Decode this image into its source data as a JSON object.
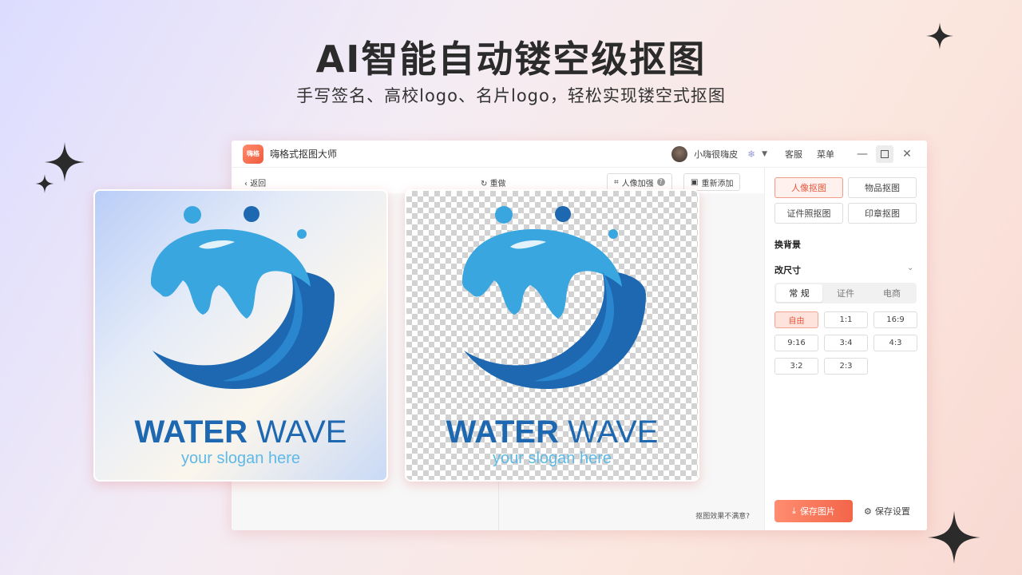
{
  "promo": {
    "headline": "AI智能自动镂空级抠图",
    "subline": "手写签名、高校logo、名片logo，轻松实现镂空式抠图"
  },
  "window": {
    "app_name": "嗨格式抠图大师",
    "app_logo_text": "嗨格",
    "username": "小嗨很嗨皮",
    "service": "客服",
    "menu": "菜单",
    "toolbar": {
      "back": "返回",
      "redo": "重做",
      "enhance": "人像加强",
      "help": "?",
      "re_add": "重新添加"
    },
    "canvas": {
      "dissatisfied": "抠图效果不满意?"
    },
    "sidebar": {
      "modes": [
        "人像抠图",
        "物品抠图",
        "证件照抠图",
        "印章抠图"
      ],
      "active_mode": "人像抠图",
      "change_bg": "换背景",
      "change_size": "改尺寸",
      "size_tabs": [
        "常 规",
        "证件",
        "电商"
      ],
      "ratios": [
        "自由",
        "1:1",
        "16:9",
        "9:16",
        "3:4",
        "4:3",
        "3:2",
        "2:3"
      ],
      "save_image": "保存图片",
      "save_settings": "保存设置"
    }
  },
  "cards": {
    "logo_word_bold": "WATER",
    "logo_word_light": "WAVE",
    "slogan": "your slogan here"
  },
  "colors": {
    "accent": "#f3654a",
    "logo_dark_blue": "#1d68b0",
    "logo_light_blue": "#3aa6e0"
  }
}
